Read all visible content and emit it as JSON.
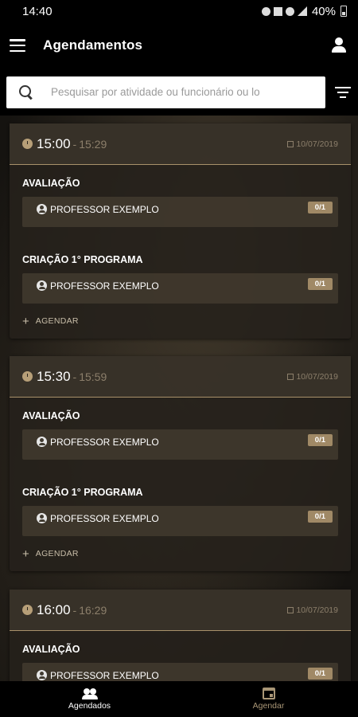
{
  "status_bar": {
    "time": "14:40",
    "battery": "40%"
  },
  "app_bar": {
    "title": "Agendamentos"
  },
  "search": {
    "placeholder": "Pesquisar por atividade ou funcionário ou lo"
  },
  "schedule_label": "AGENDAR",
  "slots": [
    {
      "start": "15:00",
      "end": "15:29",
      "date": "10/07/2019",
      "activities": [
        {
          "title": "AVALIAÇÃO",
          "staff": "PROFESSOR EXEMPLO",
          "capacity": "0/1"
        },
        {
          "title": "CRIAÇÃO 1° PROGRAMA",
          "staff": "PROFESSOR EXEMPLO",
          "capacity": "0/1"
        }
      ]
    },
    {
      "start": "15:30",
      "end": "15:59",
      "date": "10/07/2019",
      "activities": [
        {
          "title": "AVALIAÇÃO",
          "staff": "PROFESSOR EXEMPLO",
          "capacity": "0/1"
        },
        {
          "title": "CRIAÇÃO 1° PROGRAMA",
          "staff": "PROFESSOR EXEMPLO",
          "capacity": "0/1"
        }
      ]
    },
    {
      "start": "16:00",
      "end": "16:29",
      "date": "10/07/2019",
      "activities": [
        {
          "title": "AVALIAÇÃO",
          "staff": "PROFESSOR EXEMPLO",
          "capacity": "0/1"
        }
      ]
    }
  ],
  "bottom_nav": {
    "items": [
      {
        "label": "Agendados",
        "icon": "group-icon",
        "active": true
      },
      {
        "label": "Agendar",
        "icon": "calendar-event-icon",
        "active": false
      }
    ]
  }
}
